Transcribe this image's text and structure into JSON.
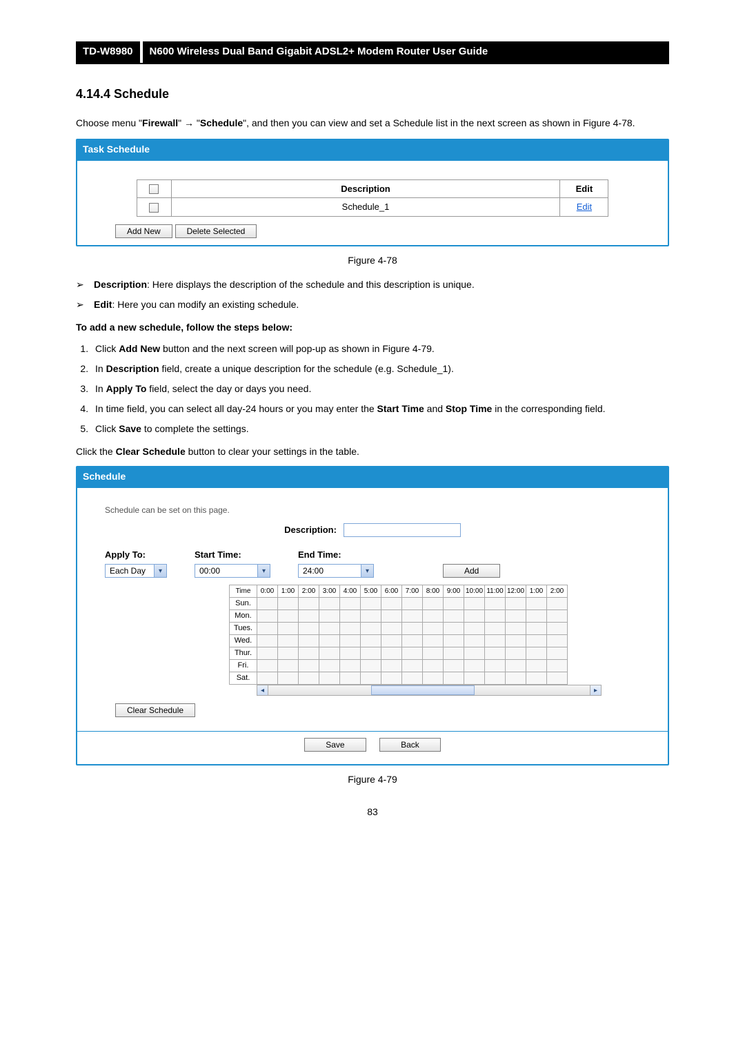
{
  "header": {
    "model": "TD-W8980",
    "title": "N600 Wireless Dual Band Gigabit ADSL2+ Modem Router User Guide"
  },
  "section_title": "4.14.4 Schedule",
  "intro_pre": "Choose menu \"",
  "intro_firewall": "Firewall",
  "intro_arrow": "\" → \"",
  "intro_schedule": "Schedule",
  "intro_post": "\", and then you can view and set a Schedule list in the next screen as shown in Figure 4-78.",
  "panel1": {
    "title": "Task Schedule",
    "col_desc": "Description",
    "col_edit": "Edit",
    "row1_desc": "Schedule_1",
    "row1_edit": "Edit",
    "btn_add": "Add New",
    "btn_del": "Delete Selected"
  },
  "fig78": "Figure 4-78",
  "bullets": {
    "b1_bold": "Description",
    "b1_rest": ": Here displays the description of the schedule and this description is unique.",
    "b2_bold": "Edit",
    "b2_rest": ": Here you can modify an existing schedule."
  },
  "steps_title": "To add a new schedule, follow the steps below:",
  "steps": {
    "s1a": "Click ",
    "s1b": "Add New",
    "s1c": " button and the next screen will pop-up as shown in Figure 4-79.",
    "s2a": "In ",
    "s2b": "Description",
    "s2c": " field, create a unique description for the schedule (e.g. Schedule_1).",
    "s3a": "In ",
    "s3b": "Apply To",
    "s3c": " field, select the day or days you need.",
    "s4a": "In time field, you can select all day-24 hours or you may enter the ",
    "s4b": "Start Time",
    "s4c": " and ",
    "s4d": "Stop Time",
    "s4e": " in the corresponding field.",
    "s5a": "Click ",
    "s5b": "Save",
    "s5c": " to complete the settings."
  },
  "clear_line_a": "Click the ",
  "clear_line_b": "Clear Schedule",
  "clear_line_c": " button to clear your settings in the table.",
  "panel2": {
    "title": "Schedule",
    "hint": "Schedule can be set on this page.",
    "desc_label": "Description:",
    "apply_label": "Apply To:",
    "apply_value": "Each Day",
    "start_label": "Start Time:",
    "start_value": "00:00",
    "end_label": "End Time:",
    "end_value": "24:00",
    "add_btn": "Add",
    "grid_time": "Time",
    "hours": [
      "0:00",
      "1:00",
      "2:00",
      "3:00",
      "4:00",
      "5:00",
      "6:00",
      "7:00",
      "8:00",
      "9:00",
      "10:00",
      "11:00",
      "12:00",
      "1:00",
      "2:00"
    ],
    "days": [
      "Sun.",
      "Mon.",
      "Tues.",
      "Wed.",
      "Thur.",
      "Fri.",
      "Sat."
    ],
    "clear_btn": "Clear Schedule",
    "save_btn": "Save",
    "back_btn": "Back"
  },
  "fig79": "Figure 4-79",
  "page_no": "83"
}
